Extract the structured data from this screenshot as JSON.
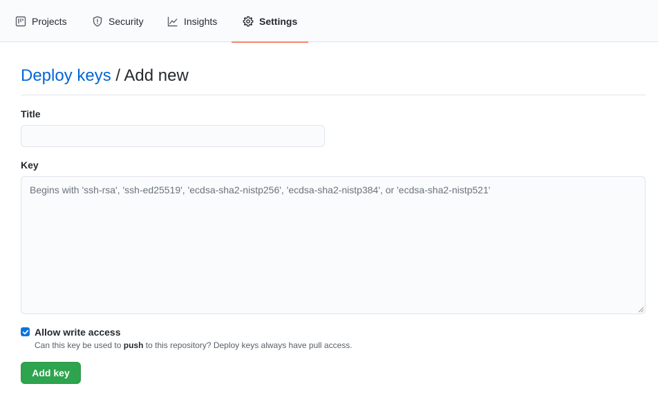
{
  "nav": {
    "tabs": [
      {
        "label": "Projects",
        "icon": "project-board-icon",
        "selected": false
      },
      {
        "label": "Security",
        "icon": "shield-icon",
        "selected": false
      },
      {
        "label": "Insights",
        "icon": "graph-icon",
        "selected": false
      },
      {
        "label": "Settings",
        "icon": "gear-icon",
        "selected": true
      }
    ]
  },
  "header": {
    "breadcrumb_link": "Deploy keys",
    "separator": "/",
    "current": "Add new"
  },
  "form": {
    "title_label": "Title",
    "title_value": "",
    "key_label": "Key",
    "key_value": "",
    "key_placeholder": "Begins with 'ssh-rsa', 'ssh-ed25519', 'ecdsa-sha2-nistp256', 'ecdsa-sha2-nistp384', or 'ecdsa-sha2-nistp521'",
    "write_access": {
      "checked": true,
      "label": "Allow write access",
      "note_before": "Can this key be used to",
      "note_bold": "push",
      "note_after": "to this repository? Deploy keys always have pull access."
    },
    "submit_label": "Add key"
  },
  "colors": {
    "link": "#0366d6",
    "primary_button": "#2ea44f",
    "selected_tab_underline": "#f9826c",
    "checkbox": "#0b74de"
  }
}
